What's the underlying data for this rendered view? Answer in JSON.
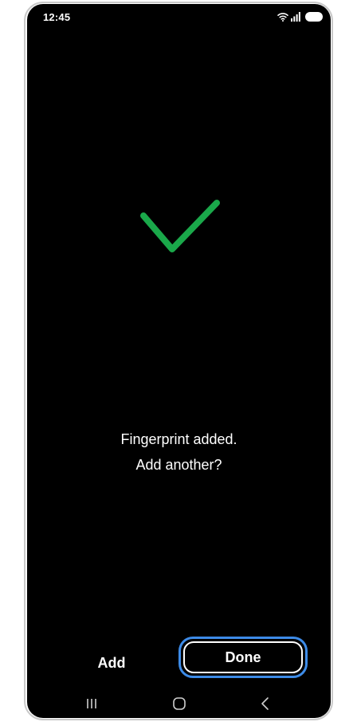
{
  "status_bar": {
    "time": "12:45",
    "icons": [
      "wifi-icon",
      "signal-icon",
      "battery-icon"
    ]
  },
  "main": {
    "success_icon": "checkmark-icon",
    "success_color": "#1aa84a",
    "message_line1": "Fingerprint added.",
    "message_line2": "Add another?"
  },
  "actions": {
    "add_label": "Add",
    "done_label": "Done",
    "focus_color": "#3d8be7"
  },
  "nav_bar": {
    "icons": [
      "recent-apps-icon",
      "home-icon",
      "back-icon"
    ]
  }
}
